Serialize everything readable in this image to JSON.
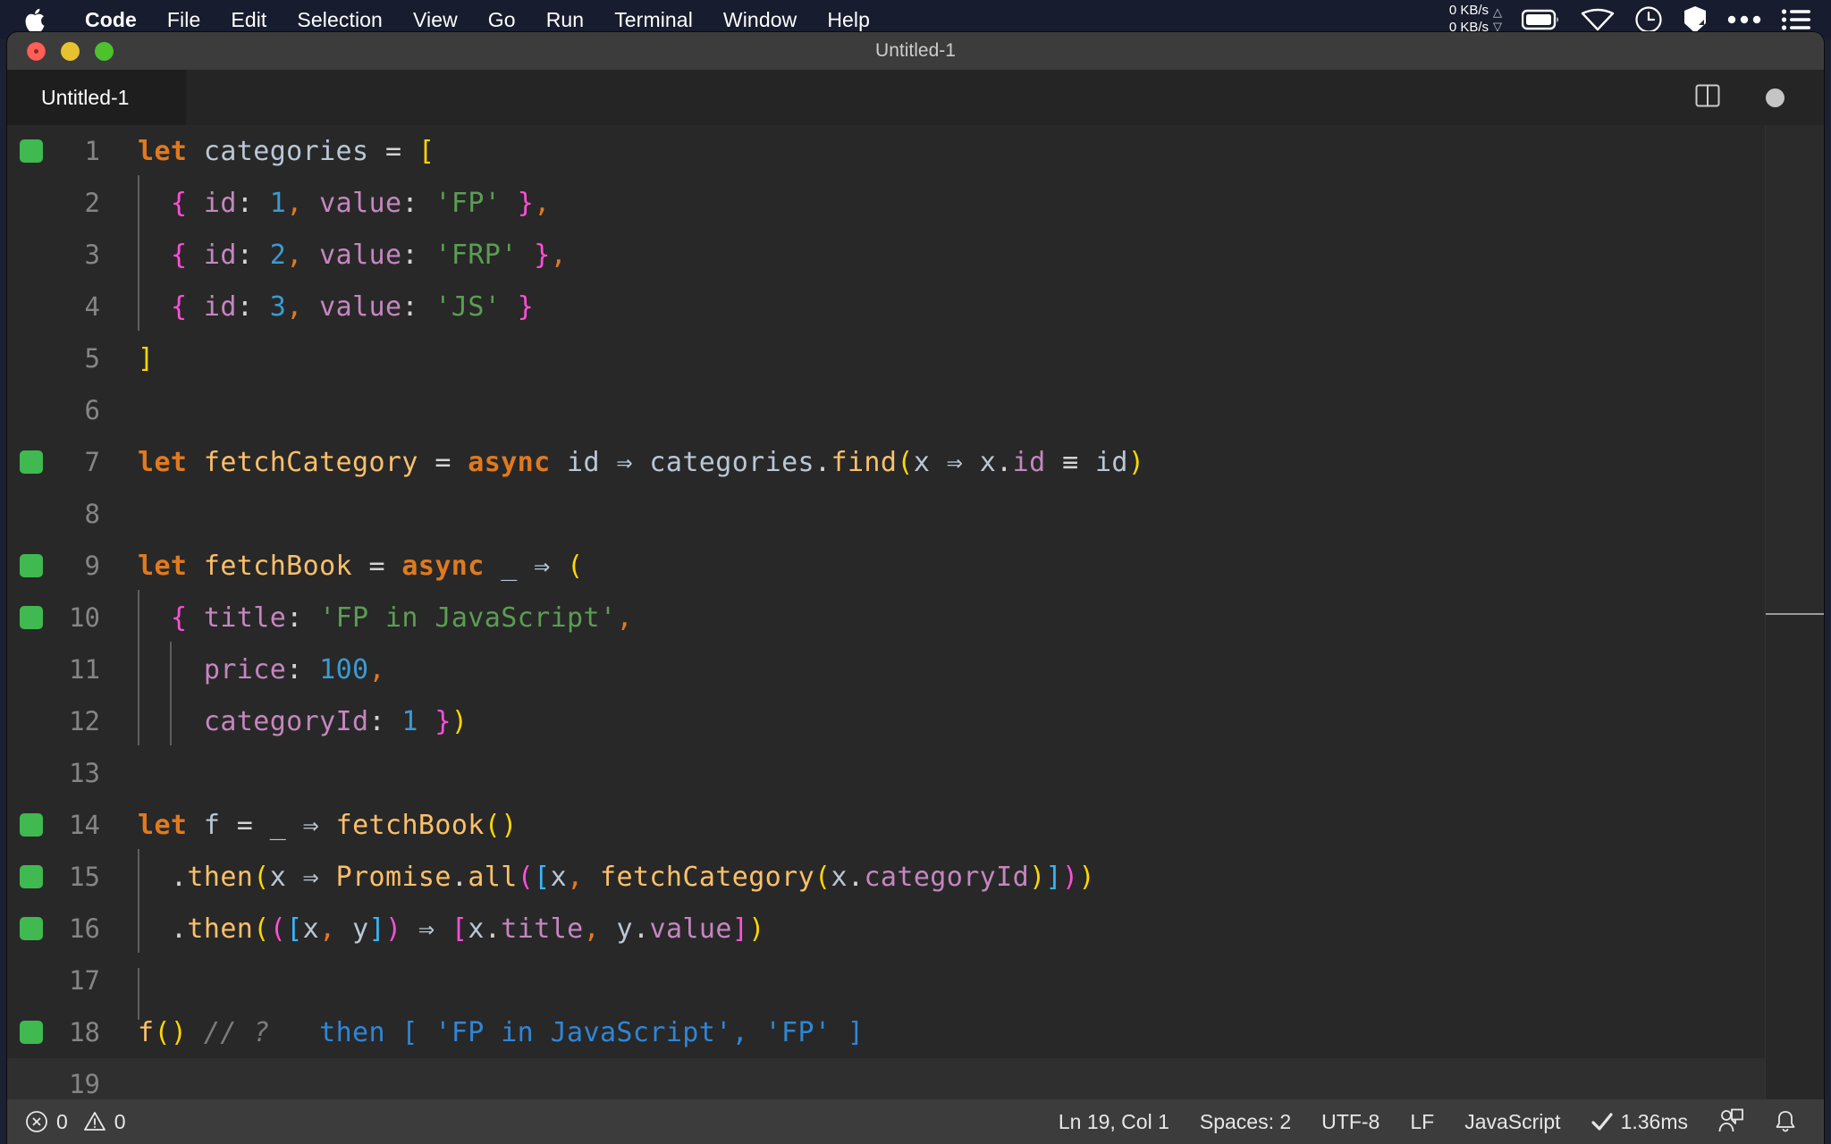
{
  "menubar": {
    "apple_icon": "apple-logo-icon",
    "items": [
      {
        "label": "Code",
        "bold": true
      },
      {
        "label": "File",
        "bold": false
      },
      {
        "label": "Edit",
        "bold": false
      },
      {
        "label": "Selection",
        "bold": false
      },
      {
        "label": "View",
        "bold": false
      },
      {
        "label": "Go",
        "bold": false
      },
      {
        "label": "Run",
        "bold": false
      },
      {
        "label": "Terminal",
        "bold": false
      },
      {
        "label": "Window",
        "bold": false
      },
      {
        "label": "Help",
        "bold": false
      }
    ],
    "network": {
      "upload": "0 KB/s",
      "download": "0 KB/s"
    },
    "tray_icons": [
      "battery-icon",
      "wifi-icon",
      "clock-icon",
      "shield-icon",
      "ellipsis-icon",
      "control-center-icon"
    ]
  },
  "window": {
    "title": "Untitled-1",
    "traffic_lights": [
      "close-button",
      "minimize-button",
      "zoom-button"
    ]
  },
  "tab": {
    "label": "Untitled-1",
    "actions": [
      "split-editor-icon",
      "unsaved-dot-icon"
    ]
  },
  "editor": {
    "accent_green": "#3fb950",
    "background": "#282828",
    "current_line": 19,
    "lines": [
      {
        "n": 1,
        "mark": true,
        "indent_guides": []
      },
      {
        "n": 2,
        "mark": false,
        "indent_guides": [
          0
        ]
      },
      {
        "n": 3,
        "mark": false,
        "indent_guides": [
          0
        ]
      },
      {
        "n": 4,
        "mark": false,
        "indent_guides": [
          0
        ]
      },
      {
        "n": 5,
        "mark": false,
        "indent_guides": []
      },
      {
        "n": 6,
        "mark": false,
        "indent_guides": []
      },
      {
        "n": 7,
        "mark": true,
        "indent_guides": []
      },
      {
        "n": 8,
        "mark": false,
        "indent_guides": []
      },
      {
        "n": 9,
        "mark": true,
        "indent_guides": []
      },
      {
        "n": 10,
        "mark": true,
        "indent_guides": [
          0
        ]
      },
      {
        "n": 11,
        "mark": false,
        "indent_guides": [
          0,
          1
        ]
      },
      {
        "n": 12,
        "mark": false,
        "indent_guides": [
          0,
          1
        ]
      },
      {
        "n": 13,
        "mark": false,
        "indent_guides": []
      },
      {
        "n": 14,
        "mark": true,
        "indent_guides": []
      },
      {
        "n": 15,
        "mark": true,
        "indent_guides": [
          0
        ]
      },
      {
        "n": 16,
        "mark": true,
        "indent_guides": [
          0
        ]
      },
      {
        "n": 17,
        "mark": false,
        "indent_guides": []
      },
      {
        "n": 18,
        "mark": true,
        "indent_guides": []
      },
      {
        "n": 19,
        "mark": false,
        "indent_guides": []
      }
    ],
    "source": [
      "let categories = [",
      "  { id: 1, value: 'FP' },",
      "  { id: 2, value: 'FRP' },",
      "  { id: 3, value: 'JS' }",
      "]",
      "",
      "let fetchCategory = async id => categories.find(x => x.id === id)",
      "",
      "let fetchBook = async _ => (",
      "  { title: 'FP in JavaScript',",
      "    price: 100,",
      "    categoryId: 1 })",
      "",
      "let f = _ => fetchBook()",
      "  .then(x => Promise.all([x, fetchCategory(x.categoryId)]))",
      "  .then(([x, y]) => [x.title, y.value])",
      "",
      "f() // ?   then [ 'FP in JavaScript', 'FP' ]",
      ""
    ],
    "inline_hint_line18": "then [ 'FP in JavaScript', 'FP' ]"
  },
  "statusbar": {
    "errors_icon": "error-circle-icon",
    "errors": "0",
    "warnings_icon": "warning-triangle-icon",
    "warnings": "0",
    "cursor": "Ln 19, Col 1",
    "indentation": "Spaces: 2",
    "encoding": "UTF-8",
    "eol": "LF",
    "language": "JavaScript",
    "check_icon": "checkmark-icon",
    "timing": "1.36ms",
    "live_share_icon": "live-share-icon",
    "bell_icon": "bell-icon"
  }
}
